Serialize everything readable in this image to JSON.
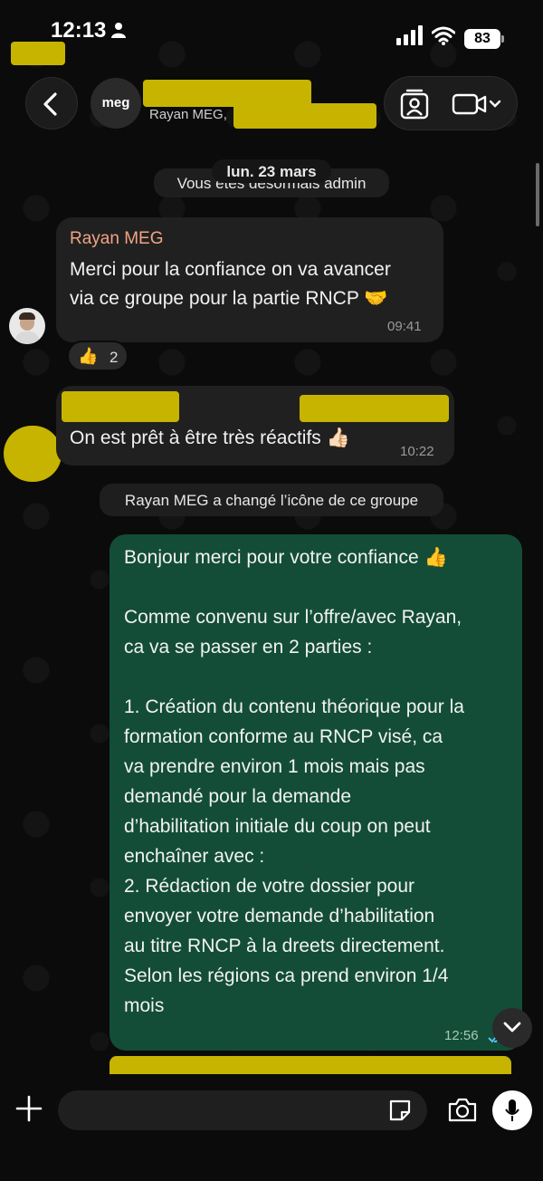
{
  "status_bar": {
    "time": "12:13",
    "battery": "83"
  },
  "header": {
    "group_avatar_text": "meg",
    "subtitle": "Rayan MEG,"
  },
  "system_messages": {
    "date": "lun. 23 mars",
    "admin_notice": "Vous êtes désormais admin",
    "icon_changed": "Rayan MEG a changé l’icône de ce groupe"
  },
  "messages": [
    {
      "sender": "Rayan MEG",
      "lines": [
        "Merci pour la confiance on va avancer",
        "via ce groupe pour la partie RNCP 🤝"
      ],
      "time": "09:41",
      "reaction": {
        "emoji": "👍",
        "count": "2"
      }
    },
    {
      "sender": "",
      "lines": [
        "On est prêt à être très réactifs 👍🏻"
      ],
      "time": "10:22"
    },
    {
      "sender": "",
      "lines": [
        "Bonjour merci pour votre confiance 👍",
        "",
        "Comme convenu sur l’offre/avec Rayan,",
        "ca va se passer en 2 parties :",
        "",
        "1. Création du contenu théorique pour la",
        "    formation conforme au RNCP visé, ca",
        "    va prendre environ 1 mois mais pas",
        "    demandé pour la demande",
        "    d’habilitation initiale du coup on peut",
        "    enchaîner avec :",
        "2. Rédaction de votre dossier pour",
        "    envoyer votre demande d’habilitation",
        "    au titre RNCP à la dreets directement.",
        "    Selon les régions ca prend environ 1/4",
        "    mois"
      ],
      "time": "12:56"
    }
  ],
  "input": {
    "placeholder": ""
  },
  "icons": {
    "back": "chevron-left-icon",
    "contact": "contact-card-icon",
    "video": "video-camera-icon",
    "plus": "plus-icon",
    "sticker": "sticker-icon",
    "camera": "camera-icon",
    "mic": "microphone-icon",
    "scroll": "chevron-down-icon"
  },
  "colors": {
    "background": "#0b0b0b",
    "incoming_bubble": "#202020",
    "outgoing_bubble": "#134d37",
    "sender_name": "#f2a384",
    "redaction": "#c6b400"
  }
}
